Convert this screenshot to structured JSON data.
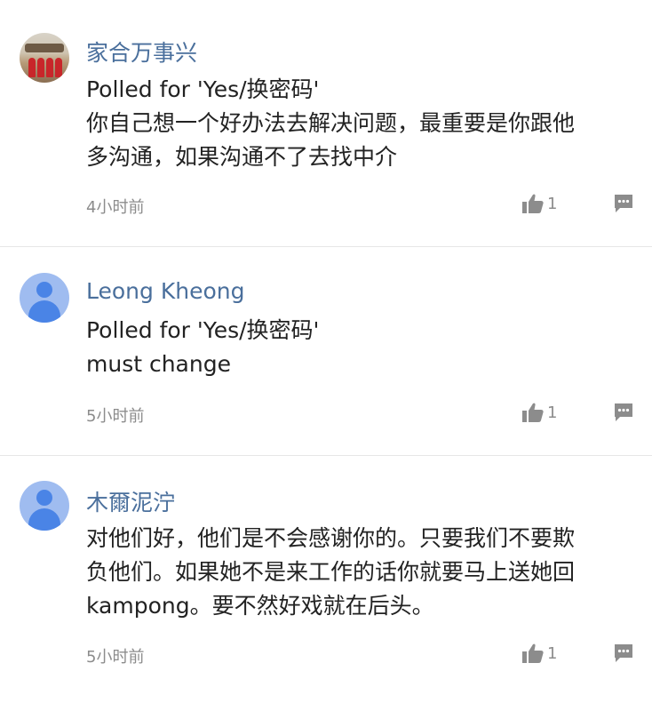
{
  "comments": [
    {
      "username": "家合万事兴",
      "avatar": "photo-avatar",
      "lines": [
        "Polled for 'Yes/换密码'",
        "你自己想一个好办法去解决问题，最重要是你跟他",
        "多沟通，如果沟通不了去找中介"
      ],
      "timestamp": "4小时前",
      "likes": "1"
    },
    {
      "username": "Leong Kheong",
      "avatar": "default-avatar",
      "lines": [
        "Polled for 'Yes/换密码'",
        "must change"
      ],
      "timestamp": "5小时前",
      "likes": "1"
    },
    {
      "username": "木爾泥泞",
      "avatar": "default-avatar",
      "lines": [
        "对他们好，他们是不会感谢你的。只要我们不要欺",
        "负他们。如果她不是来工作的话你就要马上送她回",
        "kampong。要不然好戏就在后头。"
      ],
      "timestamp": "5小时前",
      "likes": "1"
    }
  ],
  "icons": {
    "like": "thumbs-up-icon",
    "reply": "comment-bubble-icon"
  },
  "colors": {
    "username": "#4a6f9c",
    "meta": "#8c8c8c",
    "avatar_bg": "#9fbcf0",
    "avatar_fg": "#4a84e6"
  }
}
